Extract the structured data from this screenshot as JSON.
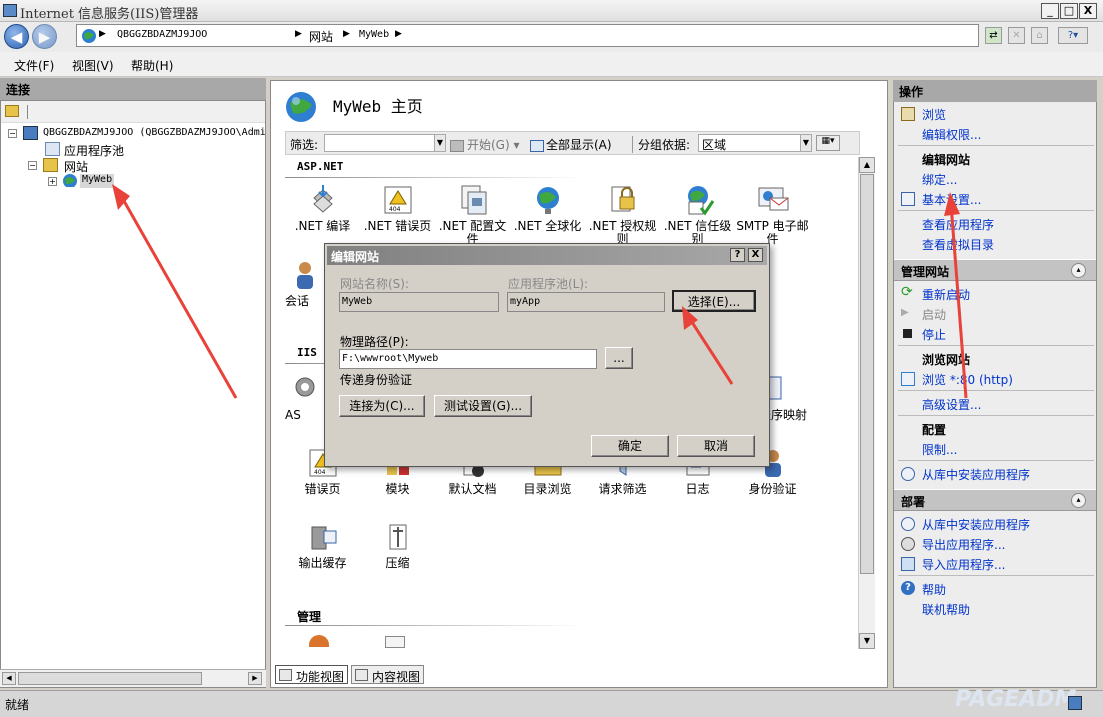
{
  "window": {
    "title": "Internet 信息服务(IIS)管理器",
    "controls": {
      "minimize": "_",
      "maximize": "□",
      "close": "X"
    }
  },
  "nav": {
    "back": "◀",
    "forward": "▶",
    "breadcrumb": [
      "QBGGZBDAZMJ9JOO",
      "网站",
      "MyWeb"
    ],
    "sep": "▶",
    "help": "?▾"
  },
  "menu": [
    "文件(F)",
    "视图(V)",
    "帮助(H)"
  ],
  "connections": {
    "header": "连接",
    "tree": {
      "server": "QBGGZBDAZMJ9JOO (QBGGZBDAZMJ9JOO\\Admi",
      "apppools": "应用程序池",
      "sites": "网站",
      "site": "MyWeb"
    }
  },
  "center": {
    "title": "MyWeb 主页",
    "filter": {
      "label": "筛选:",
      "start": "开始(G)",
      "showall": "全部显示(A)",
      "groupby": "分组依据:",
      "group_value": "区域"
    },
    "sections": {
      "aspnet": "ASP.NET",
      "iis": "IIS",
      "manage": "管理"
    },
    "aspnet_features": [
      ".NET 编译",
      ".NET 错误页",
      ".NET 配置文件",
      ".NET 全球化",
      ".NET 授权规则",
      ".NET 信任级别",
      "SMTP 电子邮件"
    ],
    "aspnet_row2": "会话",
    "iis_partial": {
      "asp": "AS",
      "handler": "程序映射"
    },
    "iis_features": [
      "错误页",
      "模块",
      "默认文档",
      "目录浏览",
      "请求筛选",
      "日志",
      "身份验证"
    ],
    "iis_row2": [
      "输出缓存",
      "压缩"
    ],
    "tabs": {
      "features": "功能视图",
      "content": "内容视图"
    }
  },
  "dialog": {
    "title": "编辑网站",
    "help": "?",
    "close": "X",
    "site_name_label": "网站名称(S):",
    "site_name": "MyWeb",
    "app_pool_label": "应用程序池(L):",
    "app_pool": "myApp",
    "select_button": "选择(E)...",
    "physical_path_label": "物理路径(P):",
    "physical_path": "F:\\wwwroot\\Myweb",
    "browse_button": "...",
    "pass_through_label": "传递身份验证",
    "connect_as_button": "连接为(C)...",
    "test_settings_button": "测试设置(G)...",
    "ok_button": "确定",
    "cancel_button": "取消"
  },
  "actions": {
    "header": "操作",
    "browse": "浏览",
    "edit_permissions": "编辑权限...",
    "edit_site_header": "编辑网站",
    "bindings": "绑定...",
    "basic_settings": "基本设置...",
    "view_apps": "查看应用程序",
    "view_vdirs": "查看虚拟目录",
    "manage_site_header": "管理网站",
    "restart": "重新启动",
    "start": "启动",
    "stop": "停止",
    "browse_site_header": "浏览网站",
    "browse_port": "浏览 *:80 (http)",
    "advanced_settings": "高级设置...",
    "config_header": "配置",
    "limits": "限制...",
    "install_from_gallery": "从库中安装应用程序",
    "deploy_header": "部署",
    "deploy_install": "从库中安装应用程序",
    "export_app": "导出应用程序...",
    "import_app": "导入应用程序...",
    "help": "帮助",
    "online_help": "联机帮助",
    "collapse": "▴"
  },
  "status": {
    "text": "就绪",
    "watermark": "PAGEADM"
  },
  "colors": {
    "link": "#0033cc",
    "header_bg": "#a8a8a8",
    "arrow": "#e8423a"
  }
}
